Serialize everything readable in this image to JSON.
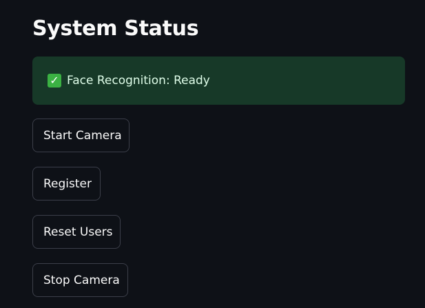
{
  "page": {
    "title": "System Status"
  },
  "status": {
    "icon": "check-icon",
    "icon_glyph": "✓",
    "text": "Face Recognition: Ready",
    "color": "#173928"
  },
  "buttons": {
    "start_camera": "Start Camera",
    "register": "Register",
    "reset_users": "Reset Users",
    "stop_camera": "Stop Camera"
  }
}
